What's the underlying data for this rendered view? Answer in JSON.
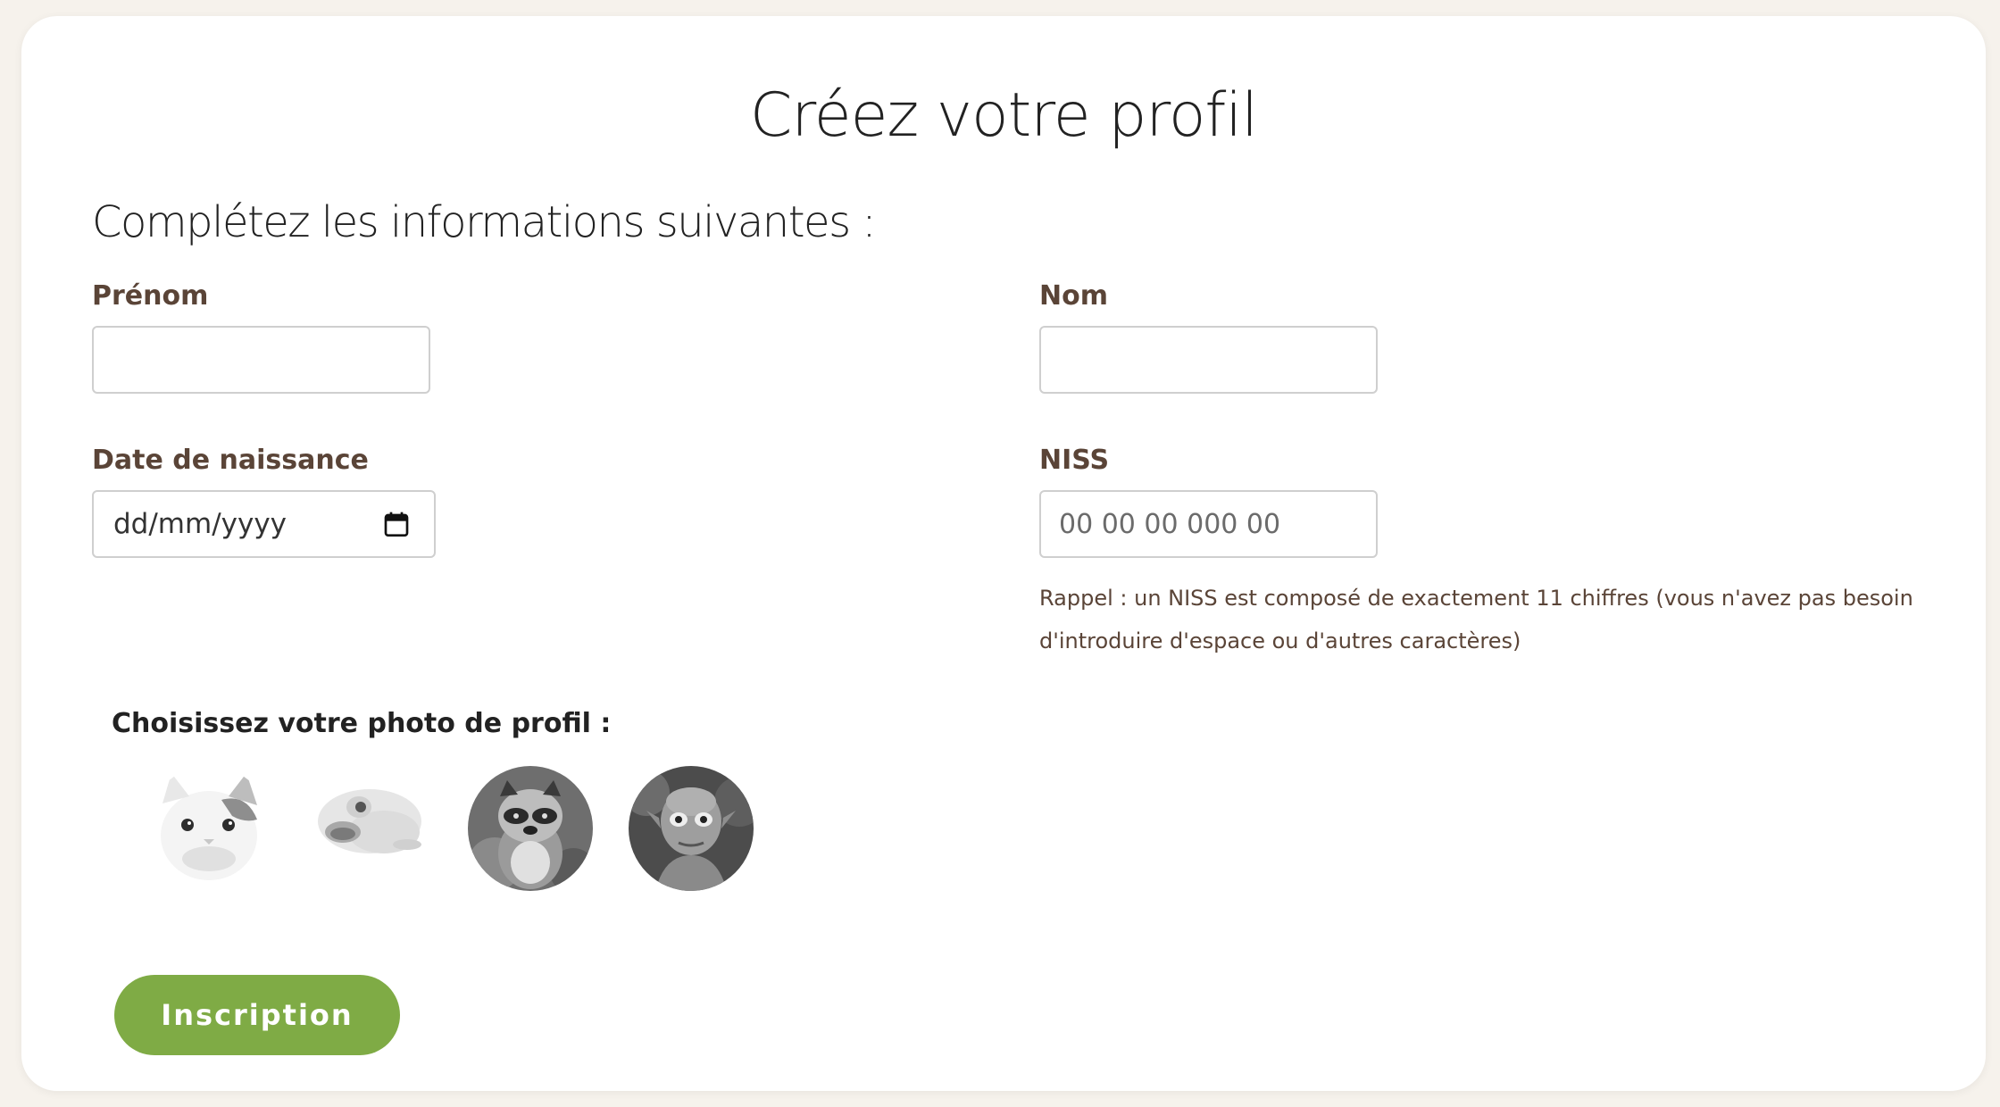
{
  "page": {
    "title": "Créez votre profil",
    "subtitle": "Complétez les informations suivantes :"
  },
  "form": {
    "first_name": {
      "label": "Prénom",
      "value": "",
      "placeholder": ""
    },
    "last_name": {
      "label": "Nom",
      "value": "",
      "placeholder": ""
    },
    "birth_date": {
      "label": "Date de naissance",
      "placeholder": "dd/mm/yyyy",
      "icon": "calendar-icon"
    },
    "niss": {
      "label": "NISS",
      "placeholder": "00 00 00 000 00",
      "hint": "Rappel : un NISS est composé de exactement 11 chiffres (vous n'avez pas besoin d'introduire d'espace ou d'autres caractères)"
    },
    "photo": {
      "label": "Choisissez votre photo de profil :",
      "options": [
        "cat-avatar",
        "frog-avatar",
        "raccoon-avatar",
        "gollum-avatar"
      ]
    },
    "submit_label": "Inscription"
  },
  "colors": {
    "background": "#f6f2ec",
    "card": "#ffffff",
    "label_brown": "#5a4437",
    "button_green": "#7fab45"
  }
}
